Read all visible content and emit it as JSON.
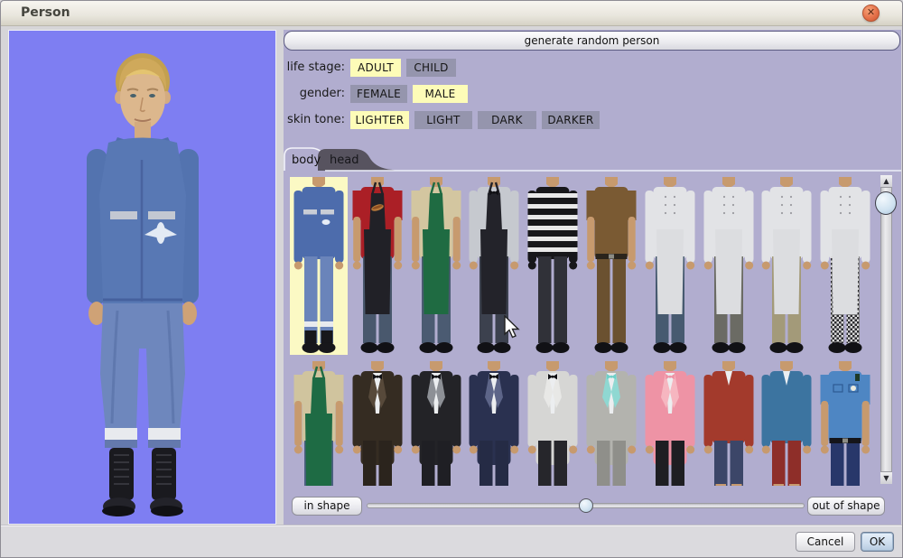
{
  "window": {
    "title": "Person"
  },
  "icons": {
    "close": "✕",
    "scroll_up": "▲",
    "scroll_down": "▼"
  },
  "generate_button": {
    "label": "generate random person"
  },
  "option_rows": [
    {
      "name": "life-stage",
      "label": "life stage:",
      "options": [
        {
          "label": "ADULT",
          "selected": true
        },
        {
          "label": "CHILD",
          "selected": false
        }
      ]
    },
    {
      "name": "gender",
      "label": "gender:",
      "options": [
        {
          "label": "FEMALE",
          "selected": false
        },
        {
          "label": "MALE",
          "selected": true
        }
      ]
    },
    {
      "name": "skin-tone",
      "label": "skin tone:",
      "options": [
        {
          "label": "LIGHTER",
          "selected": true
        },
        {
          "label": "LIGHT",
          "selected": false
        },
        {
          "label": "DARK",
          "selected": false
        },
        {
          "label": "DARKER",
          "selected": false
        }
      ]
    }
  ],
  "tabs": [
    {
      "label": "body",
      "active": true
    },
    {
      "label": "head",
      "active": false
    }
  ],
  "fitness": {
    "left_label": "in shape",
    "right_label": "out of shape",
    "slider_position_pct": 50
  },
  "dialog_buttons": {
    "cancel": "Cancel",
    "ok": "OK"
  },
  "preview": {
    "description": "adult male, lighter skin, blond hair, blue medic coveralls with reflective stripes and black boots"
  },
  "colors": {
    "preview_bg": "#7e7ef2",
    "panel_bg": "#b1adcf",
    "selected_option": "#fdfcb8",
    "unselected_option": "#9595ad",
    "selected_thumb_bg": "#fbf9c4",
    "tab_dark": "#57535f",
    "close_button": "#e5724b",
    "skin": "#c79a6e"
  },
  "thumbnails": {
    "row1": [
      {
        "name": "medic-coveralls",
        "selected": true,
        "type": "coverall",
        "top": "#4d6cac",
        "pants": "#6a84ba",
        "shoes": "#17171b",
        "band": "#c9cdd6"
      },
      {
        "name": "diner-apron-hotdog",
        "type": "apron",
        "top": "#ab1f26",
        "sleeves": "short",
        "apron": "#212127",
        "emblem": "hotdog",
        "pants": "#49586d",
        "shoes": "#111115"
      },
      {
        "name": "green-apron",
        "type": "apron",
        "top": "#d3c6a0",
        "sleeves": "short",
        "apron": "#1f6b42",
        "pants": "#4b5b72",
        "shoes": "#111115"
      },
      {
        "name": "black-apron-bowtie",
        "type": "apron",
        "sleeves": "long",
        "top": "#c6c9cf",
        "apron": "#23232a",
        "bowtie": "#101014",
        "pants": "#3c414e",
        "shoes": "#111115"
      },
      {
        "name": "prisoner-stripes",
        "type": "plain",
        "sleeves": "long",
        "top": "#17171a",
        "stripes": "#e8e8e8",
        "gloves": "#17171a",
        "pants": "#303138",
        "shoes": "#111115"
      },
      {
        "name": "brown-uniform",
        "type": "plain",
        "sleeves": "short",
        "top": "#7a5a33",
        "belt": "#2a241c",
        "pants": "#6b5130",
        "shoes": "#111115"
      },
      {
        "name": "chef-coat-blue-pants",
        "type": "chef",
        "top": "#e2e3e6",
        "apron": "#dcdde0",
        "pants": "#475a70",
        "shoes": "#111115"
      },
      {
        "name": "chef-coat-gray-pants",
        "type": "chef",
        "top": "#e2e3e6",
        "apron": "#dcdde0",
        "pants": "#6b6b64",
        "shoes": "#111115"
      },
      {
        "name": "chef-coat-khaki-pants",
        "type": "chef",
        "top": "#e2e3e6",
        "apron": "#dcdde0",
        "pants": "#a39a79",
        "shoes": "#111115"
      },
      {
        "name": "chef-coat-checkered-pants",
        "type": "chef",
        "top": "#e2e3e6",
        "apron": "#dcdde0",
        "pants": "checker",
        "shoes": "#111115"
      }
    ],
    "row2": [
      {
        "name": "long-green-apron",
        "type": "apron",
        "sleeves": "short",
        "top": "#d0c49e",
        "apron": "#1e6b44",
        "apronLong": true,
        "pants": "#4a607f",
        "shoes": "#111115"
      },
      {
        "name": "brown-tuxedo",
        "type": "tux",
        "top": "#352c22",
        "lapel": "#57493a",
        "bowtie": "#101014",
        "pants": "#2b241d",
        "shoes": "#111115"
      },
      {
        "name": "black-tuxedo",
        "type": "tux",
        "top": "#232327",
        "lapel": "#8d9096",
        "bowtie": "#101014",
        "pants": "#1f1f24",
        "shoes": "#111115"
      },
      {
        "name": "navy-tuxedo",
        "type": "tux",
        "top": "#2a3150",
        "lapel": "#5d6588",
        "bowtie": "#101014",
        "pants": "#252b45",
        "shoes": "#111115"
      },
      {
        "name": "white-tuxedo",
        "type": "tux",
        "top": "#d6d6d4",
        "lapel": "#e8e8e6",
        "bowtie": "#101014",
        "pants": "#26262b",
        "shoes": "#111115"
      },
      {
        "name": "gray-teal-tuxedo",
        "type": "tux",
        "top": "#b3b3ae",
        "lapel": "#8fd8d2",
        "bowtie": "#6fd0c8",
        "pants": "#8f8f8a",
        "shoes": "#111115"
      },
      {
        "name": "pink-tuxedo",
        "type": "tux",
        "top": "#ee93a5",
        "lapel": "#f6b6c0",
        "bowtie": "#ee93a5",
        "pants": "#1e1e22",
        "shoes": "#111115"
      },
      {
        "name": "red-cardigan-navy-shorts",
        "type": "cardigan",
        "top": "#a33a2c",
        "shorts": "#3c4668",
        "shoes": "#111115"
      },
      {
        "name": "blue-cardigan-red-shorts",
        "type": "cardigan",
        "top": "#3c74a0",
        "shorts": "#8e2e29",
        "shoes": "#111115"
      },
      {
        "name": "police-uniform",
        "type": "police",
        "sleeves": "short",
        "top": "#4e86c3",
        "belt": "#15151a",
        "pants": "#28376a",
        "shoes": "#111115"
      }
    ]
  }
}
